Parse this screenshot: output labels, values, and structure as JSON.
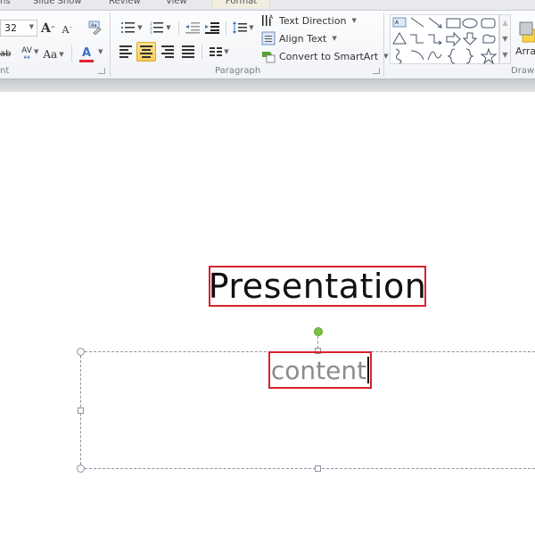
{
  "tabs": [
    {
      "label": "ns"
    },
    {
      "label": "Slide Show"
    },
    {
      "label": "Review"
    },
    {
      "label": "View"
    },
    {
      "label": "Format",
      "contextual": true
    }
  ],
  "font_group": {
    "label": "nt",
    "font_size": "32",
    "grow_font": "A",
    "shrink_font": "A",
    "char_spacing": "AV",
    "change_case": "Aa",
    "font_color_glyph": "A",
    "font_color": "#e0232c",
    "strike_glyph": "abc"
  },
  "paragraph_group": {
    "label": "Paragraph",
    "active_alignment": "center",
    "text_direction": "Text Direction",
    "align_text": "Align Text",
    "convert_smartart": "Convert to SmartArt"
  },
  "drawing_group": {
    "label": "Draw",
    "arrange": "Arra",
    "shapes": [
      "text-box",
      "line",
      "arrow",
      "rectangle",
      "oval",
      "rounded-rectangle",
      "triangle",
      "elbow-connector",
      "elbow-arrow-connector",
      "right-arrow",
      "down-arrow",
      "flowchart-shape",
      "freeform",
      "arc",
      "curve",
      "left-brace",
      "right-brace",
      "star"
    ]
  },
  "slide": {
    "title": "Presentation",
    "body_text": "content",
    "highlight_color": "#d6232c"
  }
}
